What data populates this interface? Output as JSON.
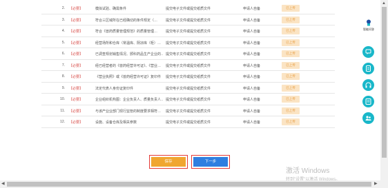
{
  "rows": [
    {
      "num": "2.",
      "req": "【必要】",
      "name": "模拟试验、确需条件",
      "type": "提交电子文件或提交纸质文件",
      "org": "申请人自备",
      "status": "已上传"
    },
    {
      "num": "3.",
      "req": "【必要】",
      "name": "符合三区域所在已经确切的条件规定（…",
      "type": "提交电子文件或提交纸质文件",
      "org": "申请人自备",
      "status": "已上传"
    },
    {
      "num": "4.",
      "req": "【必要】",
      "name": "符合《兽药质量管理规范》的质量管理…",
      "type": "提交电子文件或提交纸质文件",
      "org": "申请人自备",
      "status": "已上传"
    },
    {
      "num": "5.",
      "req": "【必要】",
      "name": "经营场所和仓库（常温库、阴凉库（柜）…",
      "type": "提交电子文件或提交纸质文件",
      "org": "申请人自备",
      "status": "已上传"
    },
    {
      "num": "6.",
      "req": "【必要】",
      "name": "已调查规划销售情况、颁科药品生产企业的…",
      "type": "提交电子文件或提交纸质文件",
      "org": "申请人自备",
      "status": "已上传"
    },
    {
      "num": "7.",
      "req": "【必要】",
      "name": "经已经营者的《兽药经营许可证》、《营业…",
      "type": "提交电子文件或提交纸质文件",
      "org": "申请人自备",
      "status": "已上传"
    },
    {
      "num": "8.",
      "req": "【必要】",
      "name": "《营业执照》或《兽药经营许可证》复印件",
      "type": "提交电子文件或提交纸质文件",
      "org": "申请人自备",
      "status": "已上传"
    },
    {
      "num": "9.",
      "req": "【必要】",
      "name": "法定代表人身份证复印件",
      "type": "提交电子文件或提交纸质文件",
      "org": "申请人自备",
      "status": "已上传"
    },
    {
      "num": "10.",
      "req": "【必要】",
      "name": "企业组织机构图：企业负责人、质量负责人…",
      "type": "提交电子文件或提交纸质文件",
      "org": "申请人自备",
      "status": "已上传"
    },
    {
      "num": "11.",
      "req": "【必要】",
      "name": "与该产业业部门现行监管的制度要求相符…",
      "type": "提交电子文件或提交纸质文件",
      "org": "申请人自备",
      "status": "已上传"
    },
    {
      "num": "12.",
      "req": "【必要】",
      "name": "设施、设备仓库及相关参数",
      "type": "提交电子文件或提交纸质文件",
      "org": "申请人自备",
      "status": "已上传"
    }
  ],
  "buttons": {
    "save": "保存",
    "next": "下一步"
  },
  "sidebar": {
    "label": "智能问答",
    "icons": [
      "chat-bubble-icon",
      "clipboard-icon",
      "headset-icon",
      "document-icon",
      "people-icon"
    ]
  },
  "watermark": {
    "line1": "激活 Windows",
    "line2": "转到\"设置\"以激活 Windows。"
  },
  "colors": {
    "status_bg": "#fbe4c4",
    "status_text": "#e8a24a",
    "required": "#d9534f",
    "save_btn": "#f0a630",
    "next_btn": "#2f7fe0",
    "sidebar_icon": "#19b7c9",
    "button_outline": "#e53935"
  }
}
